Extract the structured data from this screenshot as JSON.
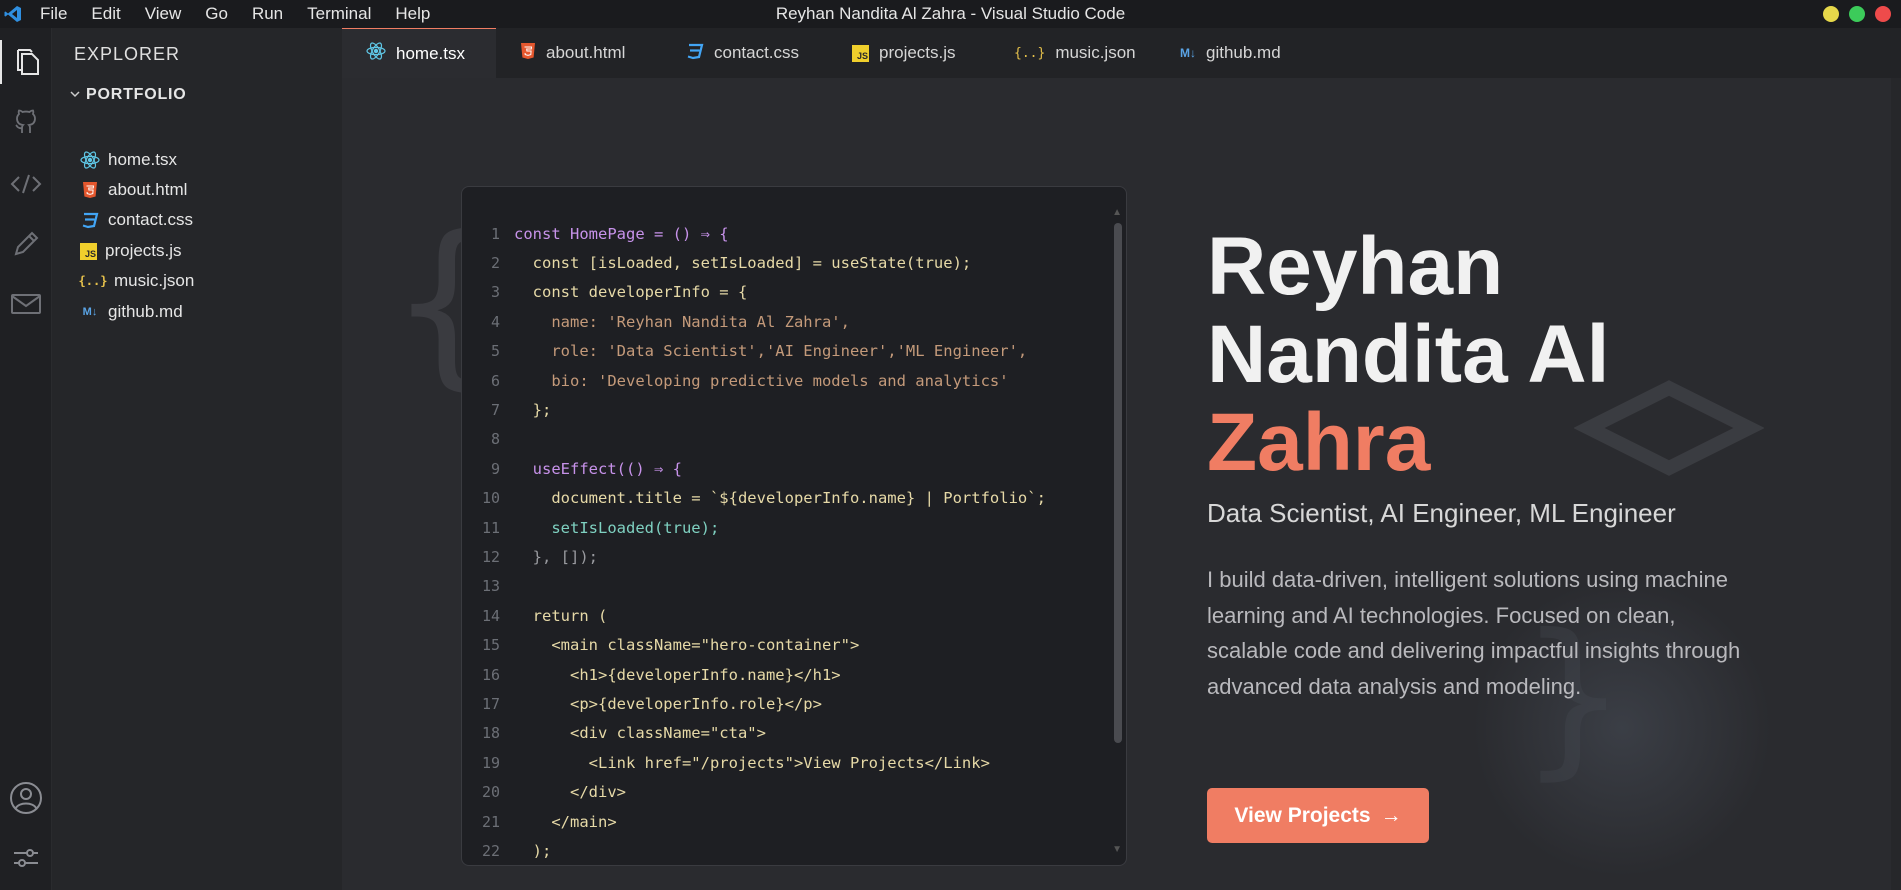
{
  "titlebar": {
    "menu": [
      "File",
      "Edit",
      "View",
      "Go",
      "Run",
      "Terminal",
      "Help"
    ],
    "window_title": "Reyhan Nandita Al Zahra - Visual Studio Code",
    "controls": [
      "#e6d84a",
      "#3ccb5a",
      "#ee4b4b"
    ]
  },
  "activity": [
    "files-icon",
    "github-icon",
    "code-icon",
    "pencil-icon",
    "mail-icon",
    "account-icon",
    "settings-sliders-icon"
  ],
  "sidebar": {
    "title": "EXPLORER",
    "folder": "PORTFOLIO",
    "files": [
      {
        "name": "home.tsx",
        "icon": "react-icon"
      },
      {
        "name": "about.html",
        "icon": "html-icon"
      },
      {
        "name": "contact.css",
        "icon": "css-icon"
      },
      {
        "name": "projects.js",
        "icon": "js-icon"
      },
      {
        "name": "music.json",
        "icon": "json-icon"
      },
      {
        "name": "github.md",
        "icon": "markdown-icon"
      }
    ]
  },
  "tabs": [
    {
      "label": "home.tsx",
      "icon": "react-icon",
      "active": true
    },
    {
      "label": "about.html",
      "icon": "html-icon"
    },
    {
      "label": "contact.css",
      "icon": "css-icon"
    },
    {
      "label": "projects.js",
      "icon": "js-icon"
    },
    {
      "label": "music.json",
      "icon": "json-icon"
    },
    {
      "label": "github.md",
      "icon": "markdown-icon"
    }
  ],
  "code": [
    {
      "n": "1",
      "text": "const HomePage = () ⇒ {"
    },
    {
      "n": "2",
      "text": "  const [isLoaded, setIsLoaded] = useState(true);"
    },
    {
      "n": "3",
      "text": "  const developerInfo = {"
    },
    {
      "n": "4",
      "text": "    name: 'Reyhan Nandita Al Zahra',"
    },
    {
      "n": "5",
      "text": "    role: 'Data Scientist','AI Engineer','ML Engineer',"
    },
    {
      "n": "6",
      "text": "    bio: 'Developing predictive models and analytics'"
    },
    {
      "n": "7",
      "text": "  };"
    },
    {
      "n": "8",
      "text": ""
    },
    {
      "n": "9",
      "text": "  useEffect(() ⇒ {"
    },
    {
      "n": "10",
      "text": "    document.title = `${developerInfo.name} | Portfolio`;"
    },
    {
      "n": "11",
      "text": "    setIsLoaded(true);"
    },
    {
      "n": "12",
      "text": "  }, []);"
    },
    {
      "n": "13",
      "text": ""
    },
    {
      "n": "14",
      "text": "  return ("
    },
    {
      "n": "15",
      "text": "    <main className=\"hero-container\">"
    },
    {
      "n": "16",
      "text": "      <h1>{developerInfo.name}</h1>"
    },
    {
      "n": "17",
      "text": "      <p>{developerInfo.role}</p>"
    },
    {
      "n": "18",
      "text": "      <div className=\"cta\">"
    },
    {
      "n": "19",
      "text": "        <Link href=\"/projects\">View Projects</Link>"
    },
    {
      "n": "20",
      "text": "      </div>"
    },
    {
      "n": "21",
      "text": "    </main>"
    },
    {
      "n": "22",
      "text": "  );"
    }
  ],
  "hero": {
    "name_line1": "Reyhan",
    "name_line2": "Nandita Al",
    "name_line3": "Zahra",
    "role": "Data Scientist, AI Engineer, ML Engineer",
    "bio": "I build data-driven, intelligent solutions using machine learning and AI technologies. Focused on clean, scalable code and delivering impactful insights through advanced data analysis and modeling.",
    "cta_label": "View Projects",
    "cta_arrow": "→",
    "accent": "#f07d63"
  }
}
